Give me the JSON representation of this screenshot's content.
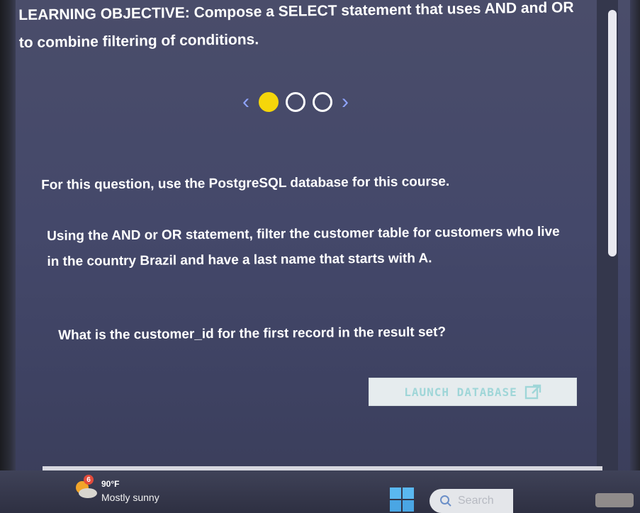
{
  "lesson": {
    "objective_label": "LEARNING OBJECTIVE:",
    "objective_text": " Compose a SELECT statement that uses AND and OR to combine filtering of conditions."
  },
  "pager": {
    "prev_icon": "chevron-left-icon",
    "next_icon": "chevron-right-icon",
    "dots": 3,
    "active_index": 0,
    "active_color": "#f5d60a"
  },
  "question": {
    "intro": "For this question, use the PostgreSQL database for this course.",
    "instruction": "Using the AND or OR statement, filter the customer table for customers who live in the country Brazil and have a last name that starts with A.",
    "prompt": "What is the customer_id for the first record in the result set?"
  },
  "actions": {
    "launch_label": "LAUNCH DATABASE",
    "launch_icon": "external-link-icon"
  },
  "taskbar": {
    "weather_badge": "6",
    "temperature": "90°F",
    "condition": "Mostly sunny",
    "search_placeholder": "Search"
  }
}
